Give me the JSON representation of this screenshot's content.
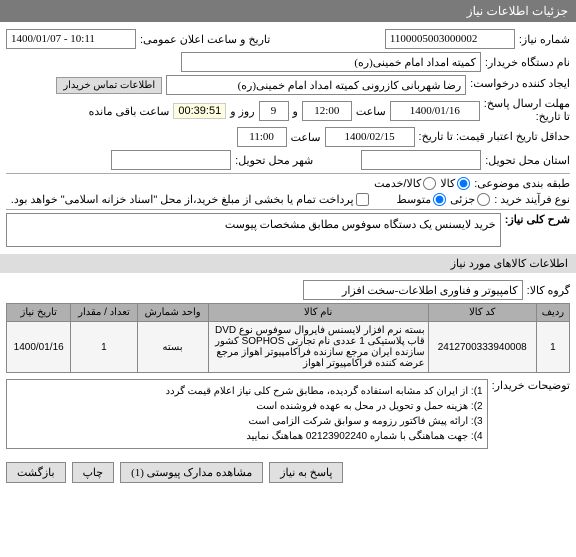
{
  "headers": {
    "main": "جزئیات اطلاعات نیاز"
  },
  "fields": {
    "need_no_label": "شماره نیاز:",
    "need_no": "1100005003000002",
    "ann_date_label": "تاریخ و ساعت اعلان عمومی:",
    "ann_date": "1400/01/07 - 10:11",
    "buyer_label": "نام دستگاه خریدار:",
    "buyer": "کمیته امداد امام خمینی(ره)",
    "creator_label": "ایجاد کننده درخواست:",
    "creator": "رضا شهربانی کازرونی کمیته امداد امام خمینی(ره)",
    "contact_btn": "اطلاعات تماس خریدار",
    "deadline_label": "مهلت ارسال پاسخ:",
    "deadline_from_label": "تا تاریخ:",
    "deadline_date": "1400/01/16",
    "hour_label": "ساعت",
    "deadline_hour": "12:00",
    "and_label": "و",
    "day_label": "روز و",
    "days_remain": "9",
    "time_remain": "00:39:51",
    "remain_label": "ساعت باقی مانده",
    "validity_label": "حداقل تاریخ اعتبار قیمت: تا تاریخ:",
    "validity_date": "1400/02/15",
    "validity_hour": "11:00",
    "province_label": "استان محل تحویل:",
    "province": "",
    "city_label": "شهر محل تحویل:",
    "city": "",
    "budget_label": "طبقه بندی موضوعی:",
    "goods_opt": "کالا",
    "service_opt": "کالا/خدمت",
    "process_label": "نوع فرآیند خرید :",
    "small_opt": "جزئی",
    "medium_opt": "متوسط",
    "payment_note": "پرداخت تمام یا بخشی از مبلغ خرید،از محل \"اسناد خزانه اسلامی\" خواهد بود.",
    "desc_label": "شرح کلی نیاز:",
    "desc_text": "خرید لایسنس یک دستگاه سوفوس مطابق مشخصات پیوست"
  },
  "goods_section": {
    "title": "اطلاعات کالاهای مورد نیاز",
    "group_label": "گروه کالا:",
    "group_value": "کامپیوتر و فناوری اطلاعات-سخت افزار"
  },
  "table": {
    "headers": {
      "row": "ردیف",
      "code": "کد کالا",
      "name": "نام کالا",
      "unit": "واحد شمارش",
      "qty": "تعداد / مقدار",
      "date": "تاریخ نیاز"
    },
    "rows": [
      {
        "row": "1",
        "code": "2412700333940008",
        "name": "بسته نرم افزار لایسنس فایروال سوفوس نوع DVD قاب پلاستیکی 1 عددی نام تجارتی SOPHOS کشور سازنده ایران مرجع سازنده فراکامپیوتر اهواز مرجع عرضه کننده فراکامپیوتر اهواز",
        "unit": "بسته",
        "qty": "1",
        "date": "1400/01/16"
      }
    ]
  },
  "explain": {
    "label": "توضیحات خریدار:",
    "line1": "1): از ایران کد مشابه استفاده گردیده، مطابق شرح کلی نیاز اعلام قیمت گردد",
    "line2": "2): هزینه حمل و تحویل در محل به عهده فروشنده است",
    "line3": "3): ارائه پیش فاکتور رزومه و سوابق شرکت الزامی است",
    "line4": "4): جهت هماهنگی با شماره 02123902240 هماهنگ نمایید"
  },
  "footer": {
    "back": "پاسخ به نیاز",
    "attach": "مشاهده مدارک پیوستی (1)",
    "print": "چاپ",
    "close": "بازگشت"
  }
}
